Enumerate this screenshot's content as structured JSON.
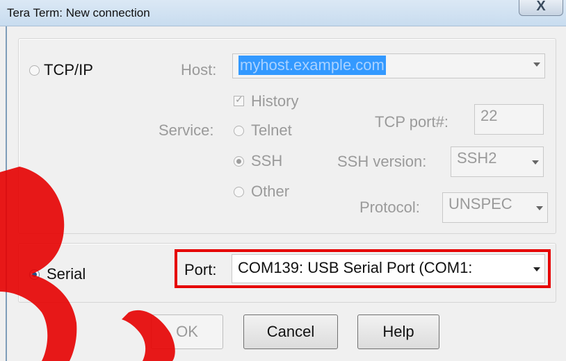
{
  "window": {
    "title": "Tera Term: New connection",
    "close_glyph": "X"
  },
  "tcpip": {
    "label": "TCP/IP",
    "selected": false,
    "host_label": "Host:",
    "host_value": "myhost.example.com",
    "history_label": "History",
    "history_checked": true,
    "service_label": "Service:",
    "services": [
      "Telnet",
      "SSH",
      "Other"
    ],
    "service_selected": "SSH",
    "tcp_port_label": "TCP port#:",
    "tcp_port_value": "22",
    "ssh_version_label": "SSH version:",
    "ssh_version_value": "SSH2",
    "protocol_label": "Protocol:",
    "protocol_value": "UNSPEC"
  },
  "serial": {
    "label": "Serial",
    "selected": true,
    "port_label": "Port:",
    "port_value": "COM139: USB Serial Port (COM1:"
  },
  "buttons": {
    "ok": "OK",
    "cancel": "Cancel",
    "help": "Help"
  },
  "colors": {
    "highlight_box": "#e60000",
    "selection": "#3399ff",
    "watermark": "#e60000"
  },
  "icons": {
    "dropdown": "chevron-down-icon",
    "close": "close-icon"
  }
}
